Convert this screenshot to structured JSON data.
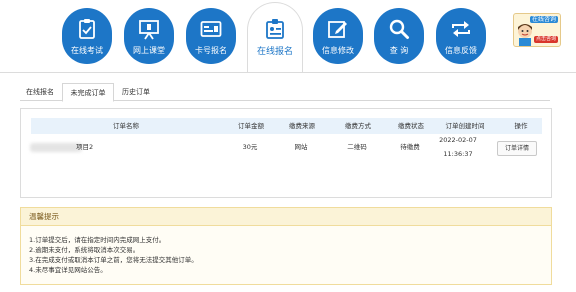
{
  "nav": {
    "items": [
      {
        "label": "在线考试",
        "icon": "clipboard-check-icon"
      },
      {
        "label": "网上课堂",
        "icon": "presentation-board-icon"
      },
      {
        "label": "卡号报名",
        "icon": "id-card-icon"
      },
      {
        "label": "在线报名",
        "icon": "badge-icon"
      },
      {
        "label": "信息修改",
        "icon": "edit-icon"
      },
      {
        "label": "查 询",
        "icon": "search-icon"
      },
      {
        "label": "信息反馈",
        "icon": "refresh-arrows-icon"
      }
    ],
    "active": "在线报名",
    "colors": {
      "nav_blue": "#1d76c7"
    }
  },
  "consult": {
    "top_label": "在线咨询",
    "bottom_label": "点击咨询"
  },
  "tabs": [
    {
      "label": "在线报名"
    },
    {
      "label": "未完成订单"
    },
    {
      "label": "历史订单"
    }
  ],
  "active_tab": "未完成订单",
  "orders": {
    "headers": [
      "订单名称",
      "订单金额",
      "缴费来源",
      "缴费方式",
      "缴费状态",
      "订单创建时间",
      "操作"
    ],
    "rows": [
      {
        "name": "项目2",
        "amount": "30元",
        "source": "网站",
        "method": "二维码",
        "status": "待缴费",
        "created_date": "2022-02-07",
        "created_time": "11:36:37",
        "action": "订单详情"
      }
    ]
  },
  "tips": {
    "title": "温馨提示",
    "lines": [
      "1.订单提交后，请在指定时间内完成网上支付。",
      "2.逾期未支付，系统将取消本次交易。",
      "3.在完成支付或取消本订单之前，您将无法提交其他订单。",
      "4.未尽事宜详见网站公告。"
    ]
  }
}
